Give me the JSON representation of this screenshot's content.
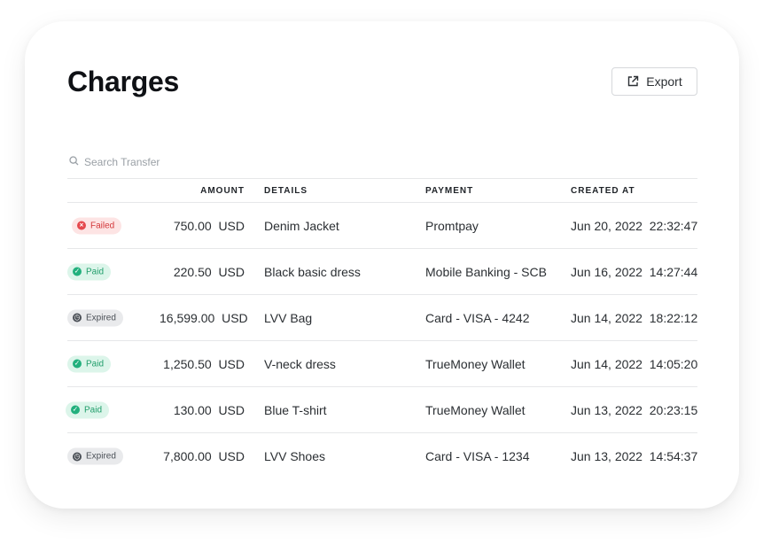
{
  "page": {
    "title": "Charges"
  },
  "toolbar": {
    "export_label": "Export"
  },
  "search": {
    "placeholder": "Search Transfer"
  },
  "table": {
    "columns": {
      "amount": "AMOUNT",
      "details": "DETAILS",
      "payment": "PAYMENT",
      "created": "CREATED AT"
    },
    "rows": [
      {
        "status": "Failed",
        "amount": "750.00",
        "currency": "USD",
        "details": "Denim Jacket",
        "payment": "Promtpay",
        "date": "Jun 20, 2022",
        "time": "22:32:47"
      },
      {
        "status": "Paid",
        "amount": "220.50",
        "currency": "USD",
        "details": "Black basic dress",
        "payment": "Mobile Banking - SCB",
        "date": "Jun 16, 2022",
        "time": "14:27:44"
      },
      {
        "status": "Expired",
        "amount": "16,599.00",
        "currency": "USD",
        "details": "LVV Bag",
        "payment": "Card - VISA - 4242",
        "date": "Jun 14, 2022",
        "time": "18:22:12"
      },
      {
        "status": "Paid",
        "amount": "1,250.50",
        "currency": "USD",
        "details": "V-neck dress",
        "payment": "TrueMoney Wallet",
        "date": "Jun 14, 2022",
        "time": "14:05:20"
      },
      {
        "status": "Paid",
        "amount": "130.00",
        "currency": "USD",
        "details": "Blue T-shirt",
        "payment": "TrueMoney Wallet",
        "date": "Jun 13, 2022",
        "time": "20:23:15"
      },
      {
        "status": "Expired",
        "amount": "7,800.00",
        "currency": "USD",
        "details": "LVV Shoes",
        "payment": "Card - VISA - 1234",
        "date": "Jun 13, 2022",
        "time": "14:54:37"
      }
    ]
  },
  "colors": {
    "failed": "#e5484d",
    "paid": "#22b07d",
    "expired": "#4b5057"
  },
  "icons": {
    "export": "external-link-icon",
    "search": "search-icon"
  }
}
